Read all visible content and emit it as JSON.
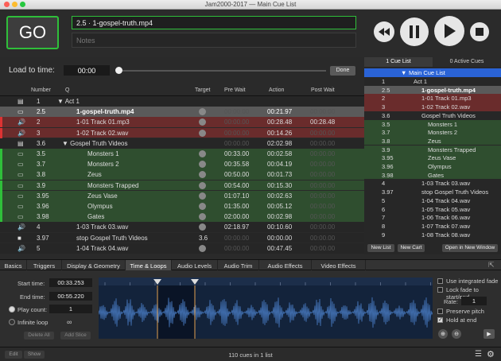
{
  "window": {
    "title": "Jam2000-2017 — Main Cue List"
  },
  "transport": {
    "go_label": "GO",
    "cue_name": "2.5 · 1-gospel-truth.mp4",
    "notes_placeholder": "Notes"
  },
  "load_time": {
    "label": "Load to time:",
    "value": "00:00",
    "done_label": "Done"
  },
  "columns": {
    "number": "Number",
    "q": "Q",
    "target": "Target",
    "pre_wait": "Pre Wait",
    "action": "Action",
    "post_wait": "Post Wait"
  },
  "cues": [
    {
      "number": "1",
      "name": "Act 1",
      "pre": "",
      "action": "",
      "post": "",
      "target": "",
      "kind": "group",
      "style": "normal"
    },
    {
      "number": "2.5",
      "name": "1-gospel-truth.mp4",
      "pre": "00:00.00",
      "action": "00:21.97",
      "post": "00:00.00",
      "target": "",
      "kind": "video",
      "style": "selected"
    },
    {
      "number": "2",
      "name": "1-01 Track 01.mp3",
      "pre": "00:00.00",
      "action": "00:28.48",
      "post": "00:28.48",
      "target": "",
      "kind": "audio",
      "style": "red"
    },
    {
      "number": "3",
      "name": "1-02 Track 02.wav",
      "pre": "00:00.00",
      "action": "00:14.26",
      "post": "00:00.00",
      "target": "",
      "kind": "audio",
      "style": "red"
    },
    {
      "number": "3.6",
      "name": "Gospel Truth Videos",
      "pre": "00:00.00",
      "action": "02:02.98",
      "post": "00:00.00",
      "target": "",
      "kind": "group",
      "style": "normal"
    },
    {
      "number": "3.5",
      "name": "Monsters 1",
      "pre": "00:33.00",
      "action": "00:02.58",
      "post": "00:00.00",
      "target": "",
      "kind": "video",
      "style": "green"
    },
    {
      "number": "3.7",
      "name": "Monsters 2",
      "pre": "00:35.58",
      "action": "00:04.19",
      "post": "00:00.00",
      "target": "",
      "kind": "video",
      "style": "green"
    },
    {
      "number": "3.8",
      "name": "Zeus",
      "pre": "00:50.00",
      "action": "00:01.73",
      "post": "00:00.00",
      "target": "",
      "kind": "video",
      "style": "green"
    },
    {
      "number": "3.9",
      "name": "Monsters Trapped",
      "pre": "00:54.00",
      "action": "00:15.30",
      "post": "00:00.00",
      "target": "",
      "kind": "video",
      "style": "green"
    },
    {
      "number": "3.95",
      "name": "Zeus Vase",
      "pre": "01:07.10",
      "action": "00:02.63",
      "post": "00:00.00",
      "target": "",
      "kind": "video",
      "style": "green"
    },
    {
      "number": "3.96",
      "name": "Olympus",
      "pre": "01:35.00",
      "action": "00:05.12",
      "post": "00:00.00",
      "target": "",
      "kind": "video",
      "style": "green"
    },
    {
      "number": "3.98",
      "name": "Gates",
      "pre": "02:00.00",
      "action": "00:02.98",
      "post": "00:00.00",
      "target": "",
      "kind": "video",
      "style": "green"
    },
    {
      "number": "4",
      "name": "1-03 Track 03.wav",
      "pre": "02:18.97",
      "action": "00:10.60",
      "post": "00:00.00",
      "target": "",
      "kind": "audio",
      "style": "normal"
    },
    {
      "number": "3.97",
      "name": "stop Gospel Truth Videos",
      "pre": "00:00.00",
      "action": "00:00.00",
      "post": "00:00.00",
      "target": "3.6",
      "kind": "stop",
      "style": "normal"
    },
    {
      "number": "5",
      "name": "1-04 Track 04.wav",
      "pre": "00:00.00",
      "action": "00:47.45",
      "post": "00:00.00",
      "target": "",
      "kind": "audio",
      "style": "normal"
    }
  ],
  "right_panel": {
    "tab_cue_list": "1 Cue List",
    "tab_active": "0 Active Cues",
    "list_title": "Main Cue List",
    "items": [
      {
        "num": "1",
        "name": "Act 1",
        "style": "normal",
        "indent": 1
      },
      {
        "num": "2.5",
        "name": "1-gospel-truth.mp4",
        "style": "selected",
        "indent": 2
      },
      {
        "num": "2",
        "name": "1-01 Track 01.mp3",
        "style": "red",
        "indent": 2
      },
      {
        "num": "3",
        "name": "1-02 Track 02.wav",
        "style": "red",
        "indent": 2
      },
      {
        "num": "3.6",
        "name": "Gospel Truth Videos",
        "style": "normal",
        "indent": 2
      },
      {
        "num": "3.5",
        "name": "Monsters 1",
        "style": "green",
        "indent": 3
      },
      {
        "num": "3.7",
        "name": "Monsters 2",
        "style": "green",
        "indent": 3
      },
      {
        "num": "3.8",
        "name": "Zeus",
        "style": "green",
        "indent": 3
      },
      {
        "num": "3.9",
        "name": "Monsters Trapped",
        "style": "green",
        "indent": 3
      },
      {
        "num": "3.95",
        "name": "Zeus Vase",
        "style": "green",
        "indent": 3
      },
      {
        "num": "3.96",
        "name": "Olympus",
        "style": "green",
        "indent": 3
      },
      {
        "num": "3.98",
        "name": "Gates",
        "style": "green",
        "indent": 3
      },
      {
        "num": "4",
        "name": "1-03 Track 03.wav",
        "style": "normal",
        "indent": 2
      },
      {
        "num": "3.97",
        "name": "stop Gospel Truth Videos",
        "style": "normal",
        "indent": 2
      },
      {
        "num": "5",
        "name": "1-04 Track 04.wav",
        "style": "normal",
        "indent": 2
      },
      {
        "num": "6",
        "name": "1-05 Track 05.wav",
        "style": "normal",
        "indent": 2
      },
      {
        "num": "7",
        "name": "1-06 Track 06.wav",
        "style": "normal",
        "indent": 2
      },
      {
        "num": "8",
        "name": "1-07 Track 07.wav",
        "style": "normal",
        "indent": 2
      },
      {
        "num": "9",
        "name": "1-08 Track 08.wav",
        "style": "normal",
        "indent": 2
      }
    ],
    "new_list": "New List",
    "new_cart": "New Cart",
    "open_window": "Open in New Window"
  },
  "inspector_tabs": [
    "Basics",
    "Triggers",
    "Display & Geometry",
    "Time & Loops",
    "Audio Levels",
    "Audio Trim",
    "Audio Effects",
    "Video Effects"
  ],
  "inspector": {
    "start_label": "Start time:",
    "start_value": "00:33.253",
    "end_label": "End time:",
    "end_value": "00:55.220",
    "play_count_label": "Play count:",
    "play_count_value": "1",
    "infinite_label": "Infinite loop",
    "infinite_value": "∞",
    "delete_all": "Delete All",
    "add_slice": "Add Slice",
    "use_fade": "Use integrated fade",
    "lock_fade": "Lock fade to start/end",
    "rate_label": "Rate:",
    "rate_value": "1",
    "preserve_pitch": "Preserve pitch",
    "hold_at_end": "Hold at end",
    "ruler": [
      "00:00",
      "00:05",
      "00:10",
      "00:15",
      "00:20",
      "00:25",
      "00:30",
      "00:35",
      "00:40",
      "00:45",
      "00:50",
      "00:55",
      "01:00",
      "01:05"
    ]
  },
  "status": {
    "edit": "Edit",
    "show": "Show",
    "count": "110 cues in 1 list"
  },
  "colors": {
    "green": "#2fbf3a",
    "red_row": "#6a2c2c",
    "green_row": "#2f4e2f",
    "blue": "#2a63d6"
  }
}
